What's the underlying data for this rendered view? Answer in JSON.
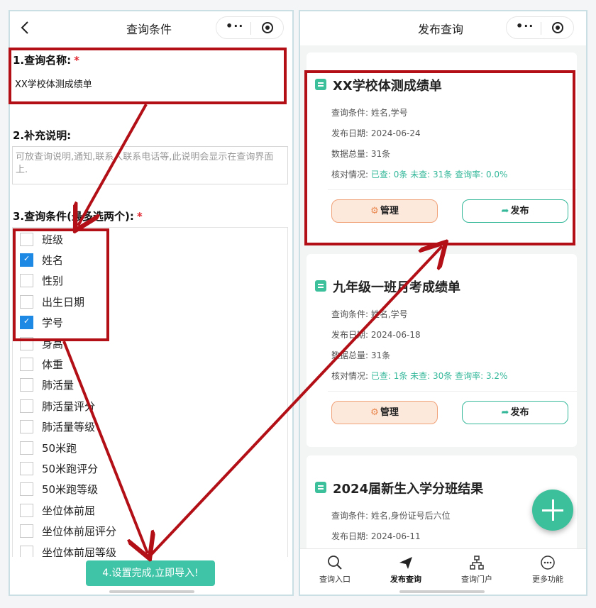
{
  "left_screen": {
    "nav_title": "查询条件",
    "back_icon": "chevron-left-icon",
    "capsule": {
      "more_icon": "•··",
      "close_icon": "target-icon"
    },
    "section1": {
      "label": "1.查询名称:",
      "required": "*",
      "value": "XX学校体测成绩单"
    },
    "section2": {
      "label": "2.补充说明:",
      "placeholder": "可放查询说明,通知,联系人联系电话等,此说明会显示在查询界面上."
    },
    "section3": {
      "label": "3.查询条件(最多选两个):",
      "required": "*"
    },
    "options": [
      {
        "label": "班级",
        "checked": false
      },
      {
        "label": "姓名",
        "checked": true
      },
      {
        "label": "性别",
        "checked": false
      },
      {
        "label": "出生日期",
        "checked": false
      },
      {
        "label": "学号",
        "checked": true
      },
      {
        "label": "身高",
        "checked": false
      },
      {
        "label": "体重",
        "checked": false
      },
      {
        "label": "肺活量",
        "checked": false
      },
      {
        "label": "肺活量评分",
        "checked": false
      },
      {
        "label": "肺活量等级",
        "checked": false
      },
      {
        "label": "50米跑",
        "checked": false
      },
      {
        "label": "50米跑评分",
        "checked": false
      },
      {
        "label": "50米跑等级",
        "checked": false
      },
      {
        "label": "坐位体前屈",
        "checked": false
      },
      {
        "label": "坐位体前屈评分",
        "checked": false
      },
      {
        "label": "坐位体前屈等级",
        "checked": false
      }
    ],
    "import_button": "4.设置完成,立即导入!"
  },
  "right_screen": {
    "nav_title": "发布查询",
    "cards": [
      {
        "title": "XX学校体测成绩单",
        "conditions": "查询条件: 姓名,学号",
        "date": "发布日期: 2024-06-24",
        "total": "数据总量: 31条",
        "check_prefix": "核对情况: ",
        "check_stats": "已查: 0条 未查: 31条 查询率: 0.0%",
        "manage_label": "管理",
        "publish_label": "发布"
      },
      {
        "title": "九年级一班月考成绩单",
        "conditions": "查询条件: 姓名,学号",
        "date": "发布日期: 2024-06-18",
        "total": "数据总量: 31条",
        "check_prefix": "核对情况: ",
        "check_stats": "已查: 1条 未查: 30条 查询率: 3.2%",
        "manage_label": "管理",
        "publish_label": "发布"
      },
      {
        "title": "2024届新生入学分班结果",
        "conditions": "查询条件: 姓名,身份证号后六位",
        "date": "发布日期: 2024-06-11"
      }
    ],
    "fab_icon": "plus-icon",
    "tabbar": [
      {
        "label": "查询入口",
        "icon": "search-icon",
        "active": false
      },
      {
        "label": "发布查询",
        "icon": "send-icon",
        "active": true
      },
      {
        "label": "查询门户",
        "icon": "sitemap-icon",
        "active": false
      },
      {
        "label": "更多功能",
        "icon": "more-icon",
        "active": false
      }
    ]
  },
  "colors": {
    "accent_green": "#3cc09b",
    "annotation_red": "#b20f17",
    "checkbox_blue": "#1e88e5",
    "manage_orange": "#f0a278"
  }
}
